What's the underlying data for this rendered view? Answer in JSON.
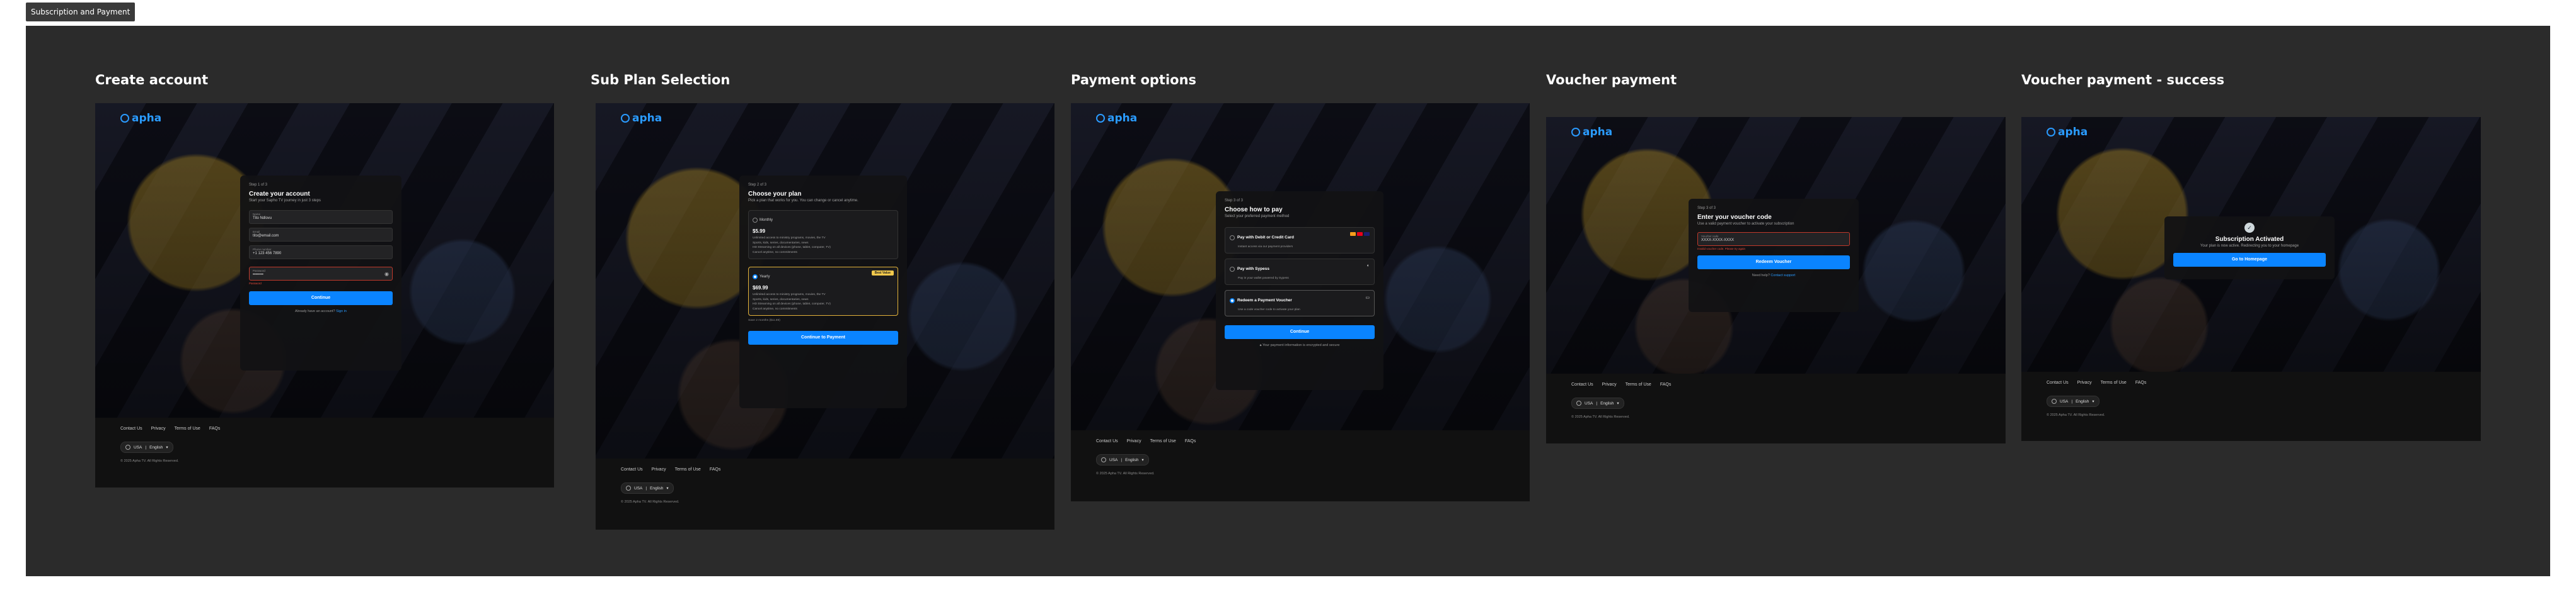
{
  "page_label": "Subscription and Payment",
  "frames": {
    "create": {
      "title": "Create account",
      "step": "Step 1 of 3",
      "heading": "Create your account",
      "subheading": "Start your Sapho TV journey in just 3 steps",
      "fields": [
        {
          "label": "Name",
          "value": "Tito Ndlovu"
        },
        {
          "label": "Email",
          "value": "tito@email.com"
        },
        {
          "label": "Phone number",
          "value": "+1 123 456 7890"
        },
        {
          "label": "Password",
          "value": "••••••••",
          "error": "Password"
        }
      ],
      "button": "Continue",
      "signin_text": "Already have an account?",
      "signin_link": "Sign in"
    },
    "plan": {
      "title": "Sub Plan Selection",
      "step": "Step 2 of 3",
      "heading": "Choose your plan",
      "subheading": "Pick a plan that works for you. You can change or cancel anytime.",
      "plans": [
        {
          "name": "Monthly",
          "price": "$5.99",
          "features": [
            "Unlimited access to ministry programs, movies, the TV",
            "Sports, kids, series, documentaries, news",
            "HD Streaming on all devices (phone, tablet, computer, TV)",
            "Cancel anytime, no commitments"
          ],
          "selected": false
        },
        {
          "name": "Yearly",
          "price": "$69.99",
          "badge": "Best Value",
          "features": [
            "Unlimited access to ministry programs, movies, the TV",
            "Sports, kids, series, documentaries, news",
            "HD Streaming on all devices (phone, tablet, computer, TV)",
            "Cancel anytime, no commitments"
          ],
          "selected": true
        }
      ],
      "note": "Save 2 months ($11.89)",
      "button": "Continue to Payment"
    },
    "payment": {
      "title": "Payment options",
      "step": "Step 3 of 3",
      "heading": "Choose how to pay",
      "subheading": "Select your preferred payment method",
      "options": [
        {
          "title": "Pay with Debit or Credit Card",
          "desc": "Instant access via our payment providers",
          "selected": false
        },
        {
          "title": "Pay with Sypess",
          "desc": "Pay in your wallet powered by Sypess",
          "selected": false
        },
        {
          "title": "Redeem a Payment Voucher",
          "desc": "Use a code voucher code to activate your plan",
          "selected": true
        }
      ],
      "button": "Continue",
      "secure_note": "Your payment information is encrypted and secure"
    },
    "voucher": {
      "title": "Voucher payment",
      "step": "Step 3 of 3",
      "heading": "Enter your voucher code",
      "subheading": "Use a valid payment voucher to activate your subscription",
      "field_label": "Voucher code",
      "field_value": "XXXX-XXXX-XXXX",
      "error": "Invalid voucher code. Please try again",
      "button": "Redeem Voucher",
      "help_text": "Need help?",
      "help_link": "Contact support"
    },
    "success": {
      "title": "Voucher payment - success",
      "heading": "Subscription Activated",
      "subheading": "Your plan is now active. Redirecting you to your homepage",
      "button": "Go to Homepage"
    }
  },
  "brand": {
    "logo": "apha"
  },
  "footer": {
    "links": [
      "Contact Us",
      "Privacy",
      "Terms of Use",
      "FAQs"
    ],
    "country": "USA",
    "language": "English",
    "copyright": "© 2025 Apha TV. All Rights Reserved."
  },
  "colors": {
    "accent": "#0a84ff",
    "canvas": "#2b2b2b",
    "badge": "#f2c94c"
  }
}
